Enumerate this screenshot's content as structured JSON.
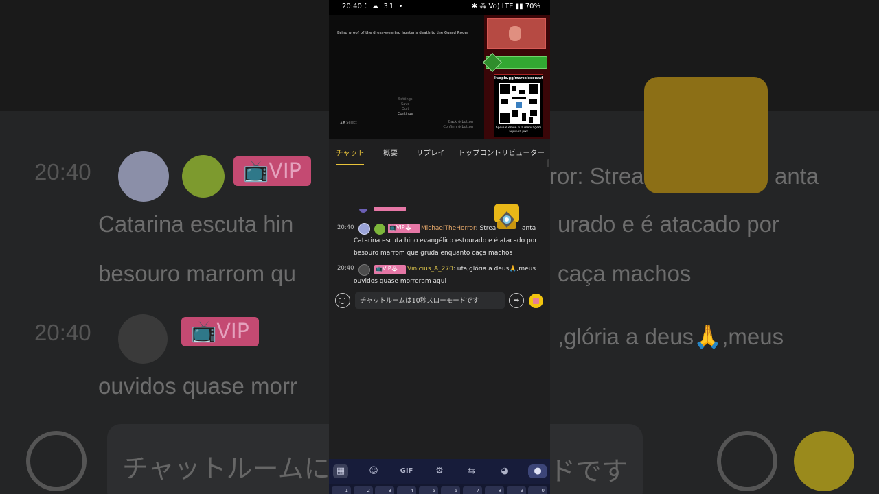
{
  "status_bar": {
    "time": "20:40",
    "left_icons": "⁚ ☁ 31 •",
    "right_icons": "✱ ⁂ Vo) LTE ▮▮ 70%"
  },
  "video": {
    "objective": "Bring proof of the dress-wearing hunter's death to the Guard Room",
    "menu": [
      "Settings",
      "Save",
      "Quit",
      "Continue"
    ],
    "select_hint": "▲▼ Select",
    "back_hint": "Back ⊗ button",
    "confirm_hint": "Confirm ⊗ button",
    "qr_url": "livepix.gg/marcelosouzaf",
    "qr_caption": "Apoie e envie sua mensagem aqui via pix!"
  },
  "tabs": [
    {
      "label": "チャット",
      "active": true
    },
    {
      "label": "概要",
      "active": false
    },
    {
      "label": "リプレイ",
      "active": false
    },
    {
      "label": "トップコントリビューター",
      "active": false
    }
  ],
  "messages": [
    {
      "time": "20:40",
      "badge": "📺VIP🕹",
      "username": "MichaelTheHorror",
      "line1": "Streamer joga jogo onde Santa",
      "line1_visible_start": "Strea",
      "line1_visible_end": "anta",
      "line2": "Catarina escuta hino evangélico estourado e é atacado por",
      "line3": "besouro marrom que gruda enquanto caça machos"
    },
    {
      "time": "20:40",
      "badge": "📺VIP🕹",
      "username": "Vinicius_A_270",
      "line1": "ufa,glória a deus🙏,meus",
      "line2": "ouvidos quase morreram aqui"
    }
  ],
  "input": {
    "placeholder": "チャットルームは10秒スローモードです"
  },
  "keyboard": {
    "gif_label": "GIF",
    "keys": [
      "1",
      "2",
      "3",
      "4",
      "5",
      "6",
      "7",
      "8",
      "9",
      "0"
    ]
  },
  "background": {
    "time1": "20:40",
    "time2": "20:40",
    "vip": "📺VIP",
    "line_a": "ror: Strea",
    "line_a2": "anta",
    "line_b": "Catarina escuta hin",
    "line_b2": "urado e é atacado por",
    "line_c": "besouro marrom qu",
    "line_c2": "caça machos",
    "line_d": ",glória a deus🙏,meus",
    "line_e": "ouvidos quase morr",
    "input_text": "チャットルームに",
    "input_text2": "ドです"
  },
  "colors": {
    "accent": "#e8c23a",
    "vip_badge": "#e677a6",
    "username": "#e5a86a"
  }
}
